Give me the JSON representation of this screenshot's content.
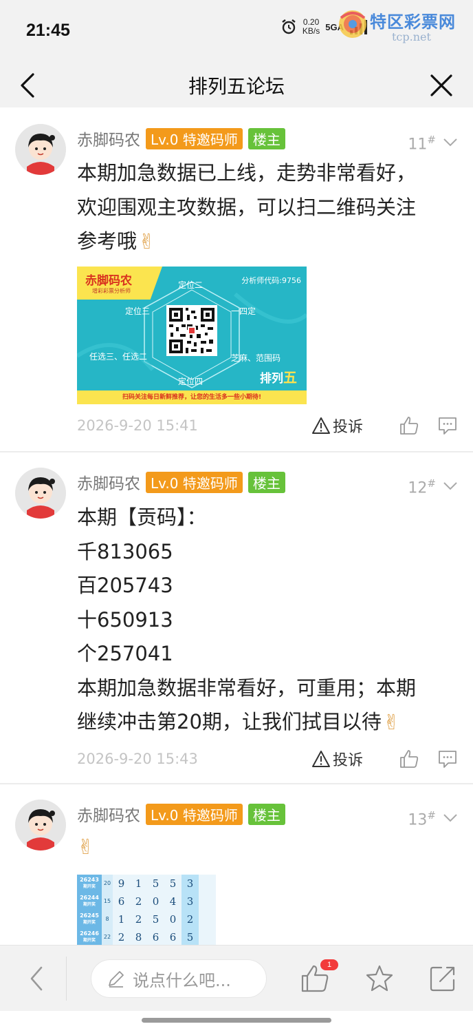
{
  "status_bar": {
    "time": "21:45",
    "net_speed_top": "0.20",
    "net_speed_unit": "KB/s",
    "signal": "5GA",
    "watermark_title": "特区彩票网",
    "watermark_url": "tcp.net"
  },
  "nav": {
    "title": "排列五论坛",
    "back_icon": "back-arrow-icon",
    "close_icon": "close-icon"
  },
  "posts": [
    {
      "author": "赤脚码农",
      "level_badge": "Lv.0 特邀码师",
      "host_badge": "楼主",
      "floor": "11",
      "floor_mark": "#",
      "lines": [
        "本期加急数据已上线，走势非常看好，",
        "欢迎围观主攻数据，可以扫二维码关注",
        "参考哦"
      ],
      "emoji": "✌",
      "time": "2026-9-20 15:41",
      "report_label": "投诉",
      "banner": {
        "logo_title": "赤脚码农",
        "logo_sub": "增彩彩票分析师",
        "code": "分析师代码:9756",
        "labels": [
          "定位二",
          "定位三",
          "一四定",
          "任选三、任选二",
          "芝麻、范围码",
          "定位四"
        ],
        "brand_prefix": "排列",
        "brand_suffix": "五",
        "footer": "扫码关注每日新鲜推荐，让您的生活多一些小期待!"
      }
    },
    {
      "author": "赤脚码农",
      "level_badge": "Lv.0 特邀码师",
      "host_badge": "楼主",
      "floor": "12",
      "floor_mark": "#",
      "lines": [
        "本期【贡码】：",
        "千813065",
        "百205743",
        "十650913",
        "个257041",
        "本期加急数据非常看好，可重用；本期",
        "继续冲击第20期，让我们拭目以待"
      ],
      "emoji": "✌",
      "time": "2026-9-20 15:43",
      "report_label": "投诉"
    },
    {
      "author": "赤脚码农",
      "level_badge": "Lv.0 特邀码师",
      "host_badge": "楼主",
      "floor": "13",
      "floor_mark": "#",
      "emoji": "✌",
      "table": {
        "rows": [
          {
            "issue": "26243",
            "sub": "期开奖",
            "sum": "20",
            "digits": [
              "9",
              "1",
              "5",
              "5",
              "3"
            ]
          },
          {
            "issue": "26244",
            "sub": "期开奖",
            "sum": "15",
            "digits": [
              "6",
              "2",
              "0",
              "4",
              "3"
            ]
          },
          {
            "issue": "26245",
            "sub": "期开奖",
            "sum": "8",
            "digits": [
              "1",
              "2",
              "5",
              "0",
              "2"
            ]
          },
          {
            "issue": "26246",
            "sub": "期开奖",
            "sum": "22",
            "digits": [
              "2",
              "8",
              "6",
              "6",
              "5"
            ]
          }
        ]
      }
    }
  ],
  "bottom_bar": {
    "comment_placeholder": "说点什么吧...",
    "like_count": "1"
  },
  "colors": {
    "level_badge": "#f39a1b",
    "host_badge": "#67c23a",
    "banner_bg": "#26b6c6",
    "banner_yellow": "#fbe44f",
    "badge_red": "#f23b3b"
  }
}
